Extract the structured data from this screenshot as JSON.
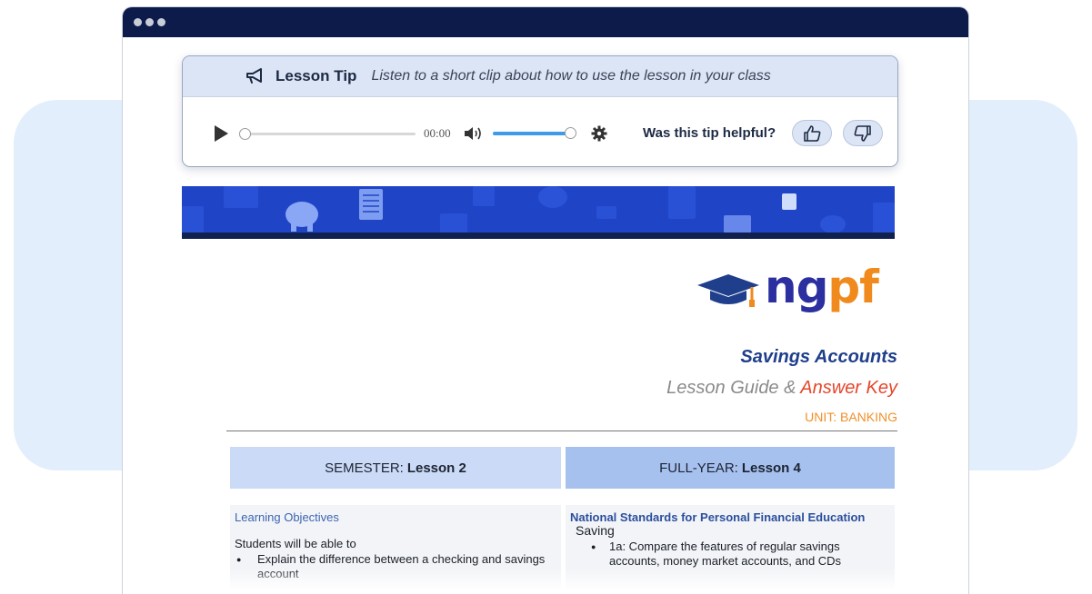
{
  "tip": {
    "title": "Lesson Tip",
    "description": "Listen to a short clip about how to use the lesson in your class",
    "time": "00:00",
    "helpful_question": "Was this tip helpful?"
  },
  "logo": {
    "text_n": "ng",
    "text_p": "pf"
  },
  "document": {
    "title": "Savings Accounts",
    "subtitle": "Lesson Guide & ",
    "subtitle_highlight": "Answer Key",
    "unit": "UNIT: BANKING",
    "semester_label": "SEMESTER:",
    "semester_value": "Lesson 2",
    "fullyear_label": "FULL-YEAR:",
    "fullyear_value": "Lesson 4",
    "objectives": {
      "heading": "Learning Objectives",
      "intro": "Students will be able to",
      "items": [
        "Explain the difference between a checking and savings account"
      ]
    },
    "standards": {
      "heading": "National Standards for Personal Financial Education",
      "category": "Saving",
      "items": [
        "1a: Compare the features of regular savings accounts, money market accounts, and CDs"
      ]
    }
  },
  "colors": {
    "titlebar": "#0d1b4a",
    "banner": "#1f44c6",
    "accent_blue": "#1f3f8c",
    "accent_orange": "#f08a1c",
    "accent_red": "#e6452a"
  }
}
